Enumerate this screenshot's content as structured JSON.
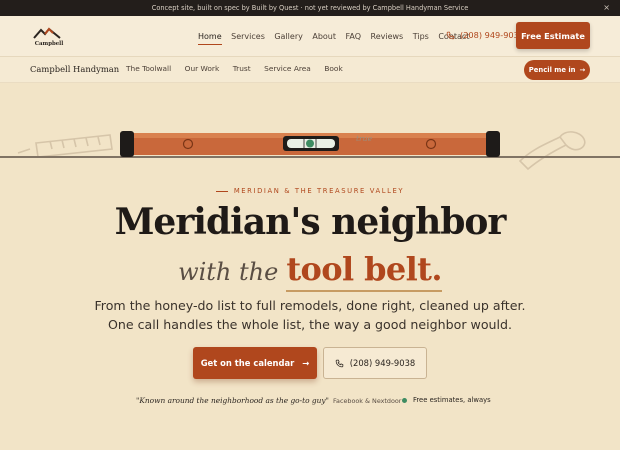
{
  "announcement": {
    "text": "Concept site, built on spec by Built by Quest · not yet reviewed by Campbell Handyman Service",
    "close_icon": "×"
  },
  "header": {
    "logo_text": "Campbell",
    "nav": [
      "Home",
      "Services",
      "Gallery",
      "About",
      "FAQ",
      "Reviews",
      "Tips",
      "Contact"
    ],
    "active_nav": "Home",
    "phone": "(208) 949-9038",
    "estimate_button": "Free Estimate"
  },
  "subnav": {
    "brand": "Campbell Handyman",
    "links": [
      "The Toolwall",
      "Our Work",
      "Trust",
      "Service Area",
      "Book"
    ],
    "cta": "Pencil me in",
    "cta_arrow": "→"
  },
  "hero": {
    "level_label": "true",
    "eyebrow": "MERIDIAN & THE TREASURE VALLEY",
    "headline": "Meridian's neighbor",
    "sub_prefix": "with the",
    "sub_accent": "tool belt.",
    "paragraph_line1": "From the honey-do list to full remodels, done right, cleaned up after.",
    "paragraph_line2": "One call handles the whole list, the way a good neighbor would.",
    "cta_primary": "Get on the calendar",
    "cta_primary_arrow": "→",
    "cta_phone": "(208) 949-9038",
    "quote": "\"Known around the neighborhood as the go-to guy\"",
    "quote_source": "Facebook & Nextdoor",
    "free_note": "Free estimates, always"
  },
  "colors": {
    "accent": "#b0471d",
    "dark": "#231e1b",
    "cream": "#f2e4c7",
    "status_dot": "#3e8c62"
  }
}
